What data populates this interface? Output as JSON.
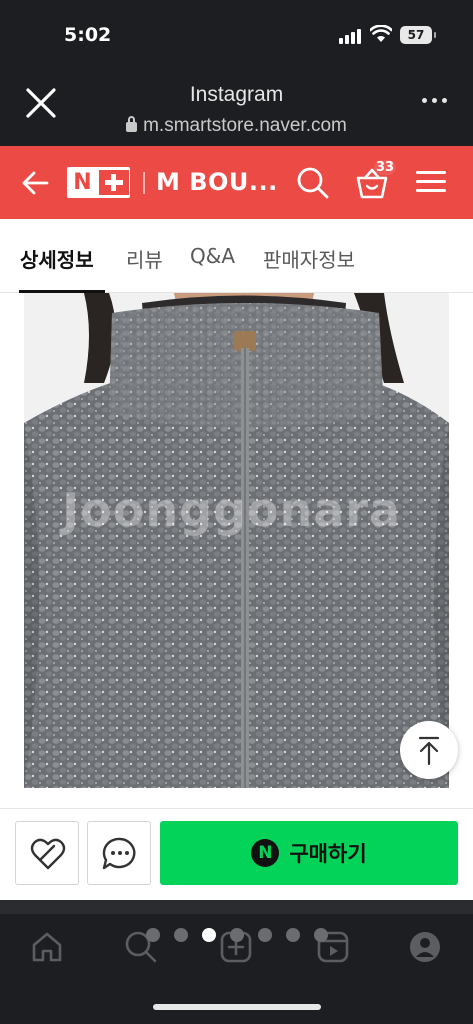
{
  "status_bar": {
    "time": "5:02",
    "battery": "57"
  },
  "browser": {
    "title": "Instagram",
    "url": "m.smartstore.naver.com"
  },
  "store": {
    "logo_n": "N",
    "name": "M BOU...",
    "cart_count": "33"
  },
  "tabs": [
    {
      "label": "상세정보",
      "active": true
    },
    {
      "label": "리뷰",
      "active": false
    },
    {
      "label": "Q&A",
      "active": false
    },
    {
      "label": "판매자정보",
      "active": false
    }
  ],
  "product": {
    "watermark": "Joonggonara",
    "image_desc_color": "#6e7073"
  },
  "action_bar": {
    "buy_icon": "N",
    "buy_label": "구매하기",
    "buy_color": "#04d35a"
  },
  "carousel": {
    "total": 7,
    "active": 2
  },
  "colors": {
    "brand_red": "#eb4a45",
    "buy_green": "#04d35a",
    "dark_bg": "#1c1e22"
  },
  "icons": [
    "close-icon",
    "more-icon",
    "back-arrow-icon",
    "search-icon",
    "cart-icon",
    "menu-icon",
    "heart-link-icon",
    "chat-icon",
    "arrow-up-icon",
    "home-icon",
    "ig-search-icon",
    "ig-create-icon",
    "reels-icon",
    "profile-icon"
  ]
}
